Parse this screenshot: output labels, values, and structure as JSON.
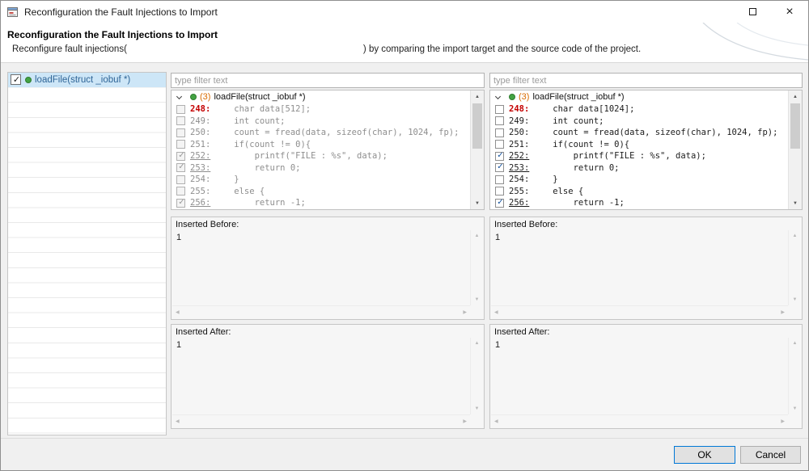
{
  "window": {
    "title": "Reconfiguration the Fault Injections to Import"
  },
  "icons": {
    "close": "×",
    "scroll_up": "▲",
    "scroll_down": "▼",
    "scroll_left": "◀",
    "scroll_right": "▶"
  },
  "colors": {
    "accent_blue": "#0078d7",
    "selection_blue": "#cde6f7",
    "line_number_red": "#c40000",
    "tree_count_orange": "#d96b00",
    "method_icon_green": "#43a343"
  },
  "header": {
    "title": "Reconfiguration the Fault Injections to Import",
    "desc_prefix": "Reconfigure fault injections(",
    "desc_suffix": ") by comparing the import target and the source code of the project."
  },
  "function_list": {
    "selected_item": {
      "label": "loadFile(struct _iobuf *)",
      "checked": true
    }
  },
  "panels": {
    "left": {
      "filter_placeholder": "type filter text",
      "tree": {
        "count": "(3)",
        "label": "loadFile(struct _iobuf *)"
      },
      "lines": [
        {
          "num": "248:",
          "code": "    char data[512];",
          "checked": false
        },
        {
          "num": "249:",
          "code": "    int count;",
          "checked": false
        },
        {
          "num": "250:",
          "code": "    count = fread(data, sizeof(char), 1024, fp);",
          "checked": false
        },
        {
          "num": "251:",
          "code": "    if(count != 0){",
          "checked": false
        },
        {
          "num": "252:",
          "code": "        printf(\"FILE : %s\", data);",
          "checked": true
        },
        {
          "num": "253:",
          "code": "        return 0;",
          "checked": true
        },
        {
          "num": "254:",
          "code": "    }",
          "checked": false
        },
        {
          "num": "255:",
          "code": "    else {",
          "checked": false
        },
        {
          "num": "256:",
          "code": "        return -1;",
          "checked": true
        }
      ],
      "inserted_before": {
        "label": "Inserted Before:",
        "value": "1"
      },
      "inserted_after": {
        "label": "Inserted After:",
        "value": "1"
      }
    },
    "right": {
      "filter_placeholder": "type filter text",
      "tree": {
        "count": "(3)",
        "label": "loadFile(struct _iobuf *)"
      },
      "lines": [
        {
          "num": "248:",
          "code": "    char data[1024];",
          "checked": false
        },
        {
          "num": "249:",
          "code": "    int count;",
          "checked": false
        },
        {
          "num": "250:",
          "code": "    count = fread(data, sizeof(char), 1024, fp);",
          "checked": false
        },
        {
          "num": "251:",
          "code": "    if(count != 0){",
          "checked": false
        },
        {
          "num": "252:",
          "code": "        printf(\"FILE : %s\", data);",
          "checked": true
        },
        {
          "num": "253:",
          "code": "        return 0;",
          "checked": true
        },
        {
          "num": "254:",
          "code": "    }",
          "checked": false
        },
        {
          "num": "255:",
          "code": "    else {",
          "checked": false
        },
        {
          "num": "256:",
          "code": "        return -1;",
          "checked": true
        }
      ],
      "inserted_before": {
        "label": "Inserted Before:",
        "value": "1"
      },
      "inserted_after": {
        "label": "Inserted After:",
        "value": "1"
      }
    }
  },
  "footer": {
    "ok_label": "OK",
    "cancel_label": "Cancel"
  }
}
